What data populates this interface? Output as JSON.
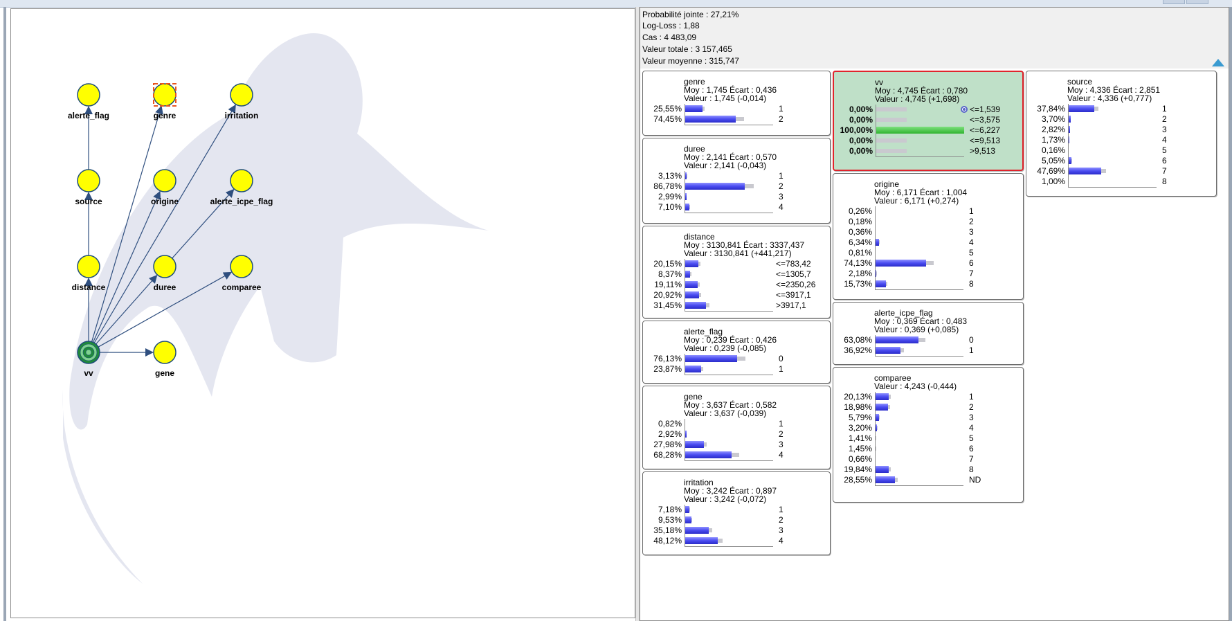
{
  "stats": [
    "Probabilité jointe : 27,21%",
    "Log-Loss : 1,88",
    "Cas : 4 483,09",
    "Valeur totale : 3 157,465",
    "Valeur moyenne : 315,747"
  ],
  "colors": {
    "node_fill": "#ffff00",
    "node_stroke": "#1f4e79",
    "edge": "#2f4f7f",
    "bar_fill": "#4a4cf0",
    "selected_bg": "#bfe0c8",
    "selected_border": "#e0242c",
    "target_node": "#1f8a3a"
  },
  "graph": {
    "nodes": [
      {
        "id": "alerte_flag",
        "label": "alerte_flag"
      },
      {
        "id": "genre",
        "label": "genre",
        "selected": true
      },
      {
        "id": "irritation",
        "label": "irritation"
      },
      {
        "id": "source",
        "label": "source"
      },
      {
        "id": "origine",
        "label": "origine"
      },
      {
        "id": "alerte_icpe_flag",
        "label": "alerte_icpe_flag"
      },
      {
        "id": "distance",
        "label": "distance"
      },
      {
        "id": "duree",
        "label": "duree"
      },
      {
        "id": "comparee",
        "label": "comparee"
      },
      {
        "id": "vv",
        "label": "vv",
        "target": true
      },
      {
        "id": "gene",
        "label": "gene"
      }
    ],
    "edges": [
      [
        "vv",
        "distance"
      ],
      [
        "distance",
        "source"
      ],
      [
        "source",
        "alerte_flag"
      ],
      [
        "vv",
        "genre"
      ],
      [
        "vv",
        "origine"
      ],
      [
        "vv",
        "irritation"
      ],
      [
        "vv",
        "duree"
      ],
      [
        "duree",
        "alerte_icpe_flag"
      ],
      [
        "vv",
        "comparee"
      ],
      [
        "vv",
        "gene"
      ]
    ]
  },
  "monitors": [
    {
      "id": "genre",
      "title": "genre",
      "moy": "Moy : 1,745 Écart : 0,436",
      "val": "Valeur : 1,745 (-0,014)",
      "states": [
        {
          "pct": "25,55%",
          "v": 25.55,
          "label": "1"
        },
        {
          "pct": "74,45%",
          "v": 74.45,
          "label": "2"
        }
      ]
    },
    {
      "id": "duree",
      "title": "duree",
      "moy": "Moy : 2,141 Écart : 0,570",
      "val": "Valeur : 2,141 (-0,043)",
      "states": [
        {
          "pct": "3,13%",
          "v": 3.13,
          "label": "1"
        },
        {
          "pct": "86,78%",
          "v": 86.78,
          "label": "2"
        },
        {
          "pct": "2,99%",
          "v": 2.99,
          "label": "3"
        },
        {
          "pct": "7,10%",
          "v": 7.1,
          "label": "4"
        }
      ]
    },
    {
      "id": "distance",
      "title": "distance",
      "moy": "Moy : 3130,841 Écart : 3337,437",
      "val": "Valeur : 3130,841 (+441,217)",
      "states": [
        {
          "pct": "20,15%",
          "v": 20.15,
          "label": "<=783,42"
        },
        {
          "pct": "8,37%",
          "v": 8.37,
          "label": "<=1305,7"
        },
        {
          "pct": "19,11%",
          "v": 19.11,
          "label": "<=2350,26"
        },
        {
          "pct": "20,92%",
          "v": 20.92,
          "label": "<=3917,1"
        },
        {
          "pct": "31,45%",
          "v": 31.45,
          "label": ">3917,1"
        }
      ]
    },
    {
      "id": "alerte_flag",
      "title": "alerte_flag",
      "moy": "Moy : 0,239 Écart : 0,426",
      "val": "Valeur : 0,239 (-0,085)",
      "states": [
        {
          "pct": "76,13%",
          "v": 76.13,
          "label": "0"
        },
        {
          "pct": "23,87%",
          "v": 23.87,
          "label": "1"
        }
      ]
    },
    {
      "id": "gene",
      "title": "gene",
      "moy": "Moy : 3,637 Écart : 0,582",
      "val": "Valeur : 3,637 (-0,039)",
      "states": [
        {
          "pct": "0,82%",
          "v": 0.82,
          "label": "1"
        },
        {
          "pct": "2,92%",
          "v": 2.92,
          "label": "2"
        },
        {
          "pct": "27,98%",
          "v": 27.98,
          "label": "3"
        },
        {
          "pct": "68,28%",
          "v": 68.28,
          "label": "4"
        }
      ]
    },
    {
      "id": "irritation",
      "title": "irritation",
      "moy": "Moy : 3,242 Écart : 0,897",
      "val": "Valeur : 3,242 (-0,072)",
      "states": [
        {
          "pct": "7,18%",
          "v": 7.18,
          "label": "1"
        },
        {
          "pct": "9,53%",
          "v": 9.53,
          "label": "2"
        },
        {
          "pct": "35,18%",
          "v": 35.18,
          "label": "3"
        },
        {
          "pct": "48,12%",
          "v": 48.12,
          "label": "4"
        }
      ]
    },
    {
      "id": "vv",
      "title": "vv",
      "moy": "Moy : 4,745 Écart : 0,780",
      "val": "Valeur : 4,745 (+1,698)",
      "selected": true,
      "states": [
        {
          "pct": "0,00%",
          "v": 0,
          "label": "<=1,539",
          "bold": true,
          "target": true
        },
        {
          "pct": "0,00%",
          "v": 0,
          "label": "<=3,575",
          "bold": true
        },
        {
          "pct": "100,00%",
          "v": 100,
          "label": "<=6,227",
          "bold": true,
          "green": true
        },
        {
          "pct": "0,00%",
          "v": 0,
          "label": "<=9,513",
          "bold": true
        },
        {
          "pct": "0,00%",
          "v": 0,
          "label": ">9,513",
          "bold": true
        }
      ]
    },
    {
      "id": "origine",
      "title": "origine",
      "moy": "Moy : 6,171 Écart : 1,004",
      "val": "Valeur : 6,171 (+0,274)",
      "states": [
        {
          "pct": "0,26%",
          "v": 0.26,
          "label": "1"
        },
        {
          "pct": "0,18%",
          "v": 0.18,
          "label": "2"
        },
        {
          "pct": "0,36%",
          "v": 0.36,
          "label": "3"
        },
        {
          "pct": "6,34%",
          "v": 6.34,
          "label": "4"
        },
        {
          "pct": "0,81%",
          "v": 0.81,
          "label": "5"
        },
        {
          "pct": "74,13%",
          "v": 74.13,
          "label": "6"
        },
        {
          "pct": "2,18%",
          "v": 2.18,
          "label": "7"
        },
        {
          "pct": "15,73%",
          "v": 15.73,
          "label": "8"
        }
      ]
    },
    {
      "id": "alerte_icpe_flag",
      "title": "alerte_icpe_flag",
      "moy": "Moy : 0,369 Écart : 0,483",
      "val": "Valeur : 0,369 (+0,085)",
      "states": [
        {
          "pct": "63,08%",
          "v": 63.08,
          "label": "0"
        },
        {
          "pct": "36,92%",
          "v": 36.92,
          "label": "1"
        }
      ]
    },
    {
      "id": "comparee",
      "title": "comparee",
      "moy": "",
      "val": "Valeur : 4,243 (-0,444)",
      "states": [
        {
          "pct": "20,13%",
          "v": 20.13,
          "label": "1"
        },
        {
          "pct": "18,98%",
          "v": 18.98,
          "label": "2"
        },
        {
          "pct": "5,79%",
          "v": 5.79,
          "label": "3"
        },
        {
          "pct": "3,20%",
          "v": 3.2,
          "label": "4"
        },
        {
          "pct": "1,41%",
          "v": 1.41,
          "label": "5"
        },
        {
          "pct": "1,45%",
          "v": 1.45,
          "label": "6"
        },
        {
          "pct": "0,66%",
          "v": 0.66,
          "label": "7"
        },
        {
          "pct": "19,84%",
          "v": 19.84,
          "label": "8"
        },
        {
          "pct": "28,55%",
          "v": 28.55,
          "label": "ND"
        }
      ]
    },
    {
      "id": "source",
      "title": "source",
      "moy": "Moy : 4,336 Écart : 2,851",
      "val": "Valeur : 4,336 (+0,777)",
      "states": [
        {
          "pct": "37,84%",
          "v": 37.84,
          "label": "1"
        },
        {
          "pct": "3,70%",
          "v": 3.7,
          "label": "2"
        },
        {
          "pct": "2,82%",
          "v": 2.82,
          "label": "3"
        },
        {
          "pct": "1,73%",
          "v": 1.73,
          "label": "4"
        },
        {
          "pct": "0,16%",
          "v": 0.16,
          "label": "5"
        },
        {
          "pct": "5,05%",
          "v": 5.05,
          "label": "6"
        },
        {
          "pct": "47,69%",
          "v": 47.69,
          "label": "7"
        },
        {
          "pct": "1,00%",
          "v": 1.0,
          "label": "8"
        }
      ]
    }
  ]
}
